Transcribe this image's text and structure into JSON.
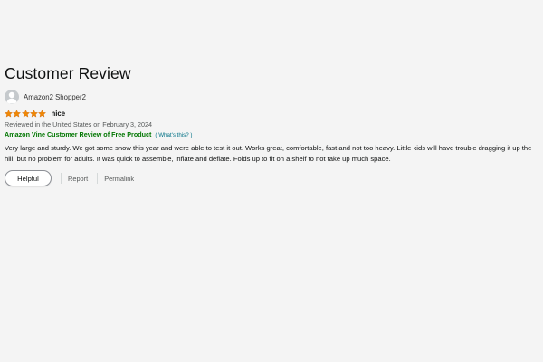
{
  "page": {
    "title": "Customer Review"
  },
  "review": {
    "author": "Amazon2 Shopper2",
    "rating": 5,
    "max_rating": 5,
    "headline": "nice",
    "date_text": "Reviewed in the United States on February 3, 2024",
    "vine_label": "Amazon Vine Customer Review of Free Product",
    "whats_this": "( What's this? )",
    "body": "Very large and sturdy. We got some snow this year and were able to test it out. Works great, comfortable, fast and not too heavy. Little kids will have trouble dragging it up the hill, but no problem for adults. It was quick to assemble, inflate and deflate. Folds up to fit on a shelf to not take up much space."
  },
  "actions": {
    "helpful_label": "Helpful",
    "report_label": "Report",
    "permalink_label": "Permalink"
  },
  "colors": {
    "star": "#f08804",
    "vine_green": "#007600",
    "link": "#007185",
    "background": "#f4f4f4"
  },
  "icons": {
    "avatar": "user-avatar-icon",
    "star": "star-icon"
  }
}
